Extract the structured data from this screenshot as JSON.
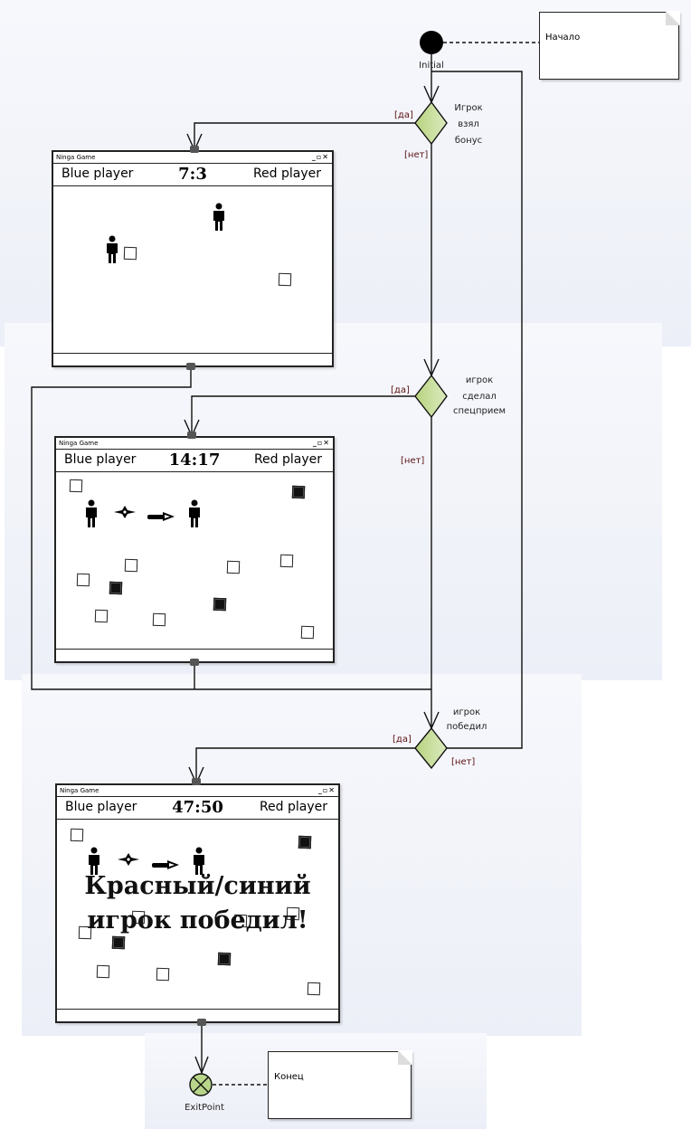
{
  "initial": {
    "label": "Initial",
    "note": "Начало"
  },
  "exit": {
    "label": "ExitPoint",
    "note": "Конец"
  },
  "decisions": [
    {
      "lines": [
        "Игрок",
        "взял",
        "бонус"
      ],
      "yes": "[да]",
      "no": "[нет]"
    },
    {
      "lines": [
        "игрок",
        "сделал",
        "спецприем"
      ],
      "yes": "[да]",
      "no": "[нет]"
    },
    {
      "lines": [
        "игрок",
        "победил"
      ],
      "yes": "[да]",
      "no": "[нет]"
    }
  ],
  "windows": [
    {
      "title": "Ninga Game",
      "controls": "_▫✕",
      "blue": "Blue player",
      "score": "7:3",
      "red": "Red player"
    },
    {
      "title": "Ninga Game",
      "controls": "_▫✕",
      "blue": "Blue player",
      "score": "14:17",
      "red": "Red player"
    },
    {
      "title": "Ninga Game",
      "controls": "_▫✕",
      "blue": "Blue player",
      "score": "47:50",
      "red": "Red player",
      "overlay": [
        "Красный/синий",
        "игрок победил!"
      ]
    }
  ],
  "colors": {
    "decision": "#c5dc94",
    "exit": "#b8d68a",
    "line": "#111111"
  }
}
